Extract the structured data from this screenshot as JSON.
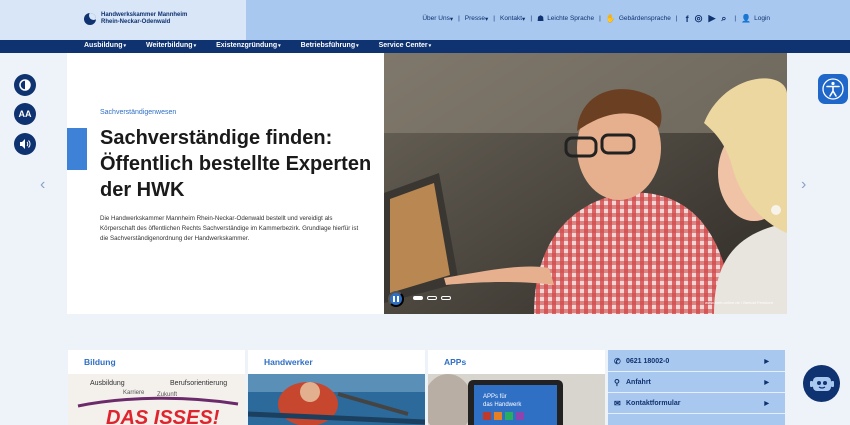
{
  "logo": {
    "line1": "Handwerkskammer Mannheim",
    "line2": "Rhein-Neckar-Odenwald"
  },
  "util": {
    "ueber_uns": "Über Uns",
    "presse": "Presse",
    "kontakt": "Kontakt",
    "leichte_sprache": "Leichte Sprache",
    "gebaerdensprache": "Gebärdensprache",
    "login": "Login",
    "social": [
      "facebook-icon",
      "instagram-icon",
      "youtube-icon"
    ]
  },
  "nav": {
    "items": [
      "Ausbildung",
      "Weiterbildung",
      "Existenzgründung",
      "Betriebsführung",
      "Service Center"
    ]
  },
  "accessibility": {
    "contrast_icon": "contrast-icon",
    "font_size_label": "AA",
    "audio_icon": "speaker-icon"
  },
  "hero": {
    "kicker": "Sachverständigenwesen",
    "title": "Sachverständige finden: Öffentlich bestellte Experten der HWK",
    "description": "Die Handwerkskammer Mannheim Rhein-Neckar-Odenwald bestellt und vereidigt als Körperschaft des öffentlichen Rechts Sachverständige im Kammerbezirk. Grundlage hierfür ist die Sachverständigenordnung der Handwerkskammer.",
    "photo_credit": "www.amh-online.de / Bertold Fernkorn",
    "slides_total": 3,
    "slide_active": 1
  },
  "cards": [
    {
      "title": "Bildung",
      "image_words": [
        "Ausbildung",
        "Karriere",
        "Zukunft",
        "Berufsorientierung",
        "DAS ISSES!"
      ]
    },
    {
      "title": "Handwerker"
    },
    {
      "title": "APPs",
      "image_text": "APPs für das Handwerk"
    }
  ],
  "quicklinks": [
    {
      "label": "0621 18002-0",
      "icon": "phone-icon"
    },
    {
      "label": "Anfahrt",
      "icon": "location-pin-icon"
    },
    {
      "label": "Kontaktformular",
      "icon": "envelope-icon"
    }
  ],
  "colors": {
    "navy": "#0f3270",
    "accent": "#3d82d6",
    "topbar": "#a9c8ef"
  }
}
